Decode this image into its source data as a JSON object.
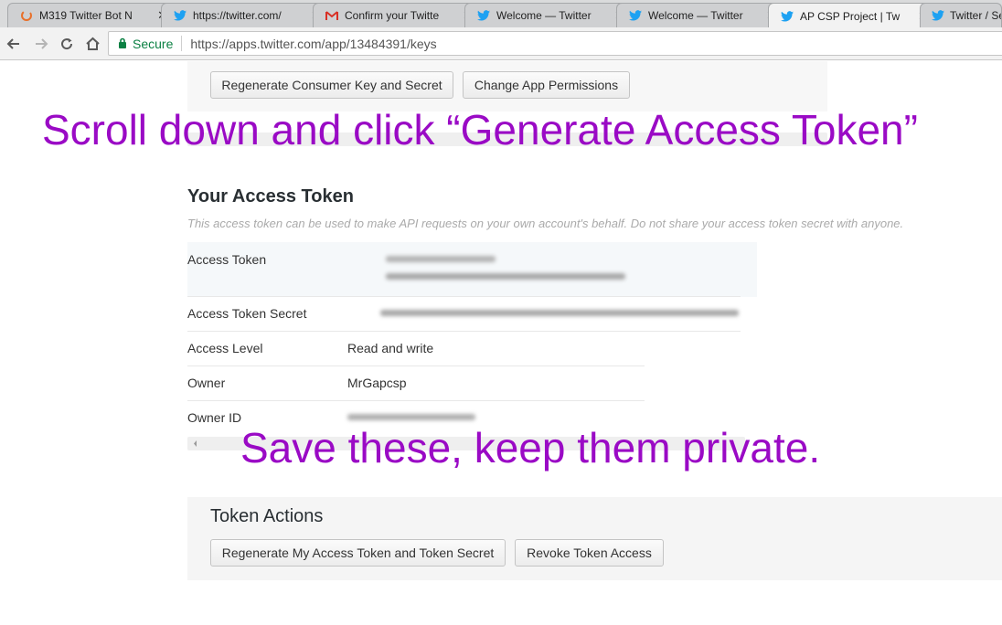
{
  "browser": {
    "tabs": [
      {
        "title": "M319 Twitter Bot N",
        "icon": "loading-ring-icon",
        "active": false
      },
      {
        "title": "https://twitter.com/",
        "icon": "twitter-bird-icon",
        "active": false
      },
      {
        "title": "Confirm your Twitte",
        "icon": "gmail-icon",
        "active": false
      },
      {
        "title": "Welcome — Twitter",
        "icon": "twitter-bird-icon",
        "active": false
      },
      {
        "title": "Welcome — Twitter",
        "icon": "twitter-bird-icon",
        "active": false
      },
      {
        "title": "AP CSP Project | Tw",
        "icon": "twitter-bird-icon",
        "active": true
      },
      {
        "title": "Twitter / Set",
        "icon": "twitter-bird-icon",
        "active": false
      }
    ],
    "close_glyph": "✕",
    "secure_label": "Secure",
    "url": "https://apps.twitter.com/app/13484391/keys"
  },
  "top_buttons": {
    "regenerate_consumer": "Regenerate Consumer Key and Secret",
    "change_permissions": "Change App Permissions"
  },
  "overlay": {
    "instruction_top": "Scroll down and click “Generate Access Token”",
    "instruction_bottom": "Save these, keep them private."
  },
  "access_token": {
    "heading": "Your Access Token",
    "description": "This access token can be used to make API requests on your own account's behalf. Do not share your access token secret with anyone.",
    "rows": {
      "token_label": "Access Token",
      "secret_label": "Access Token Secret",
      "level_label": "Access Level",
      "level_value": "Read and write",
      "owner_label": "Owner",
      "owner_value": "MrGapcsp",
      "owner_id_label": "Owner ID"
    }
  },
  "token_actions": {
    "heading": "Token Actions",
    "regenerate_button": "Regenerate My Access Token and Token Secret",
    "revoke_button": "Revoke Token Access"
  },
  "colors": {
    "overlay_text": "#9a0ac5",
    "secure_green": "#0b8043"
  }
}
